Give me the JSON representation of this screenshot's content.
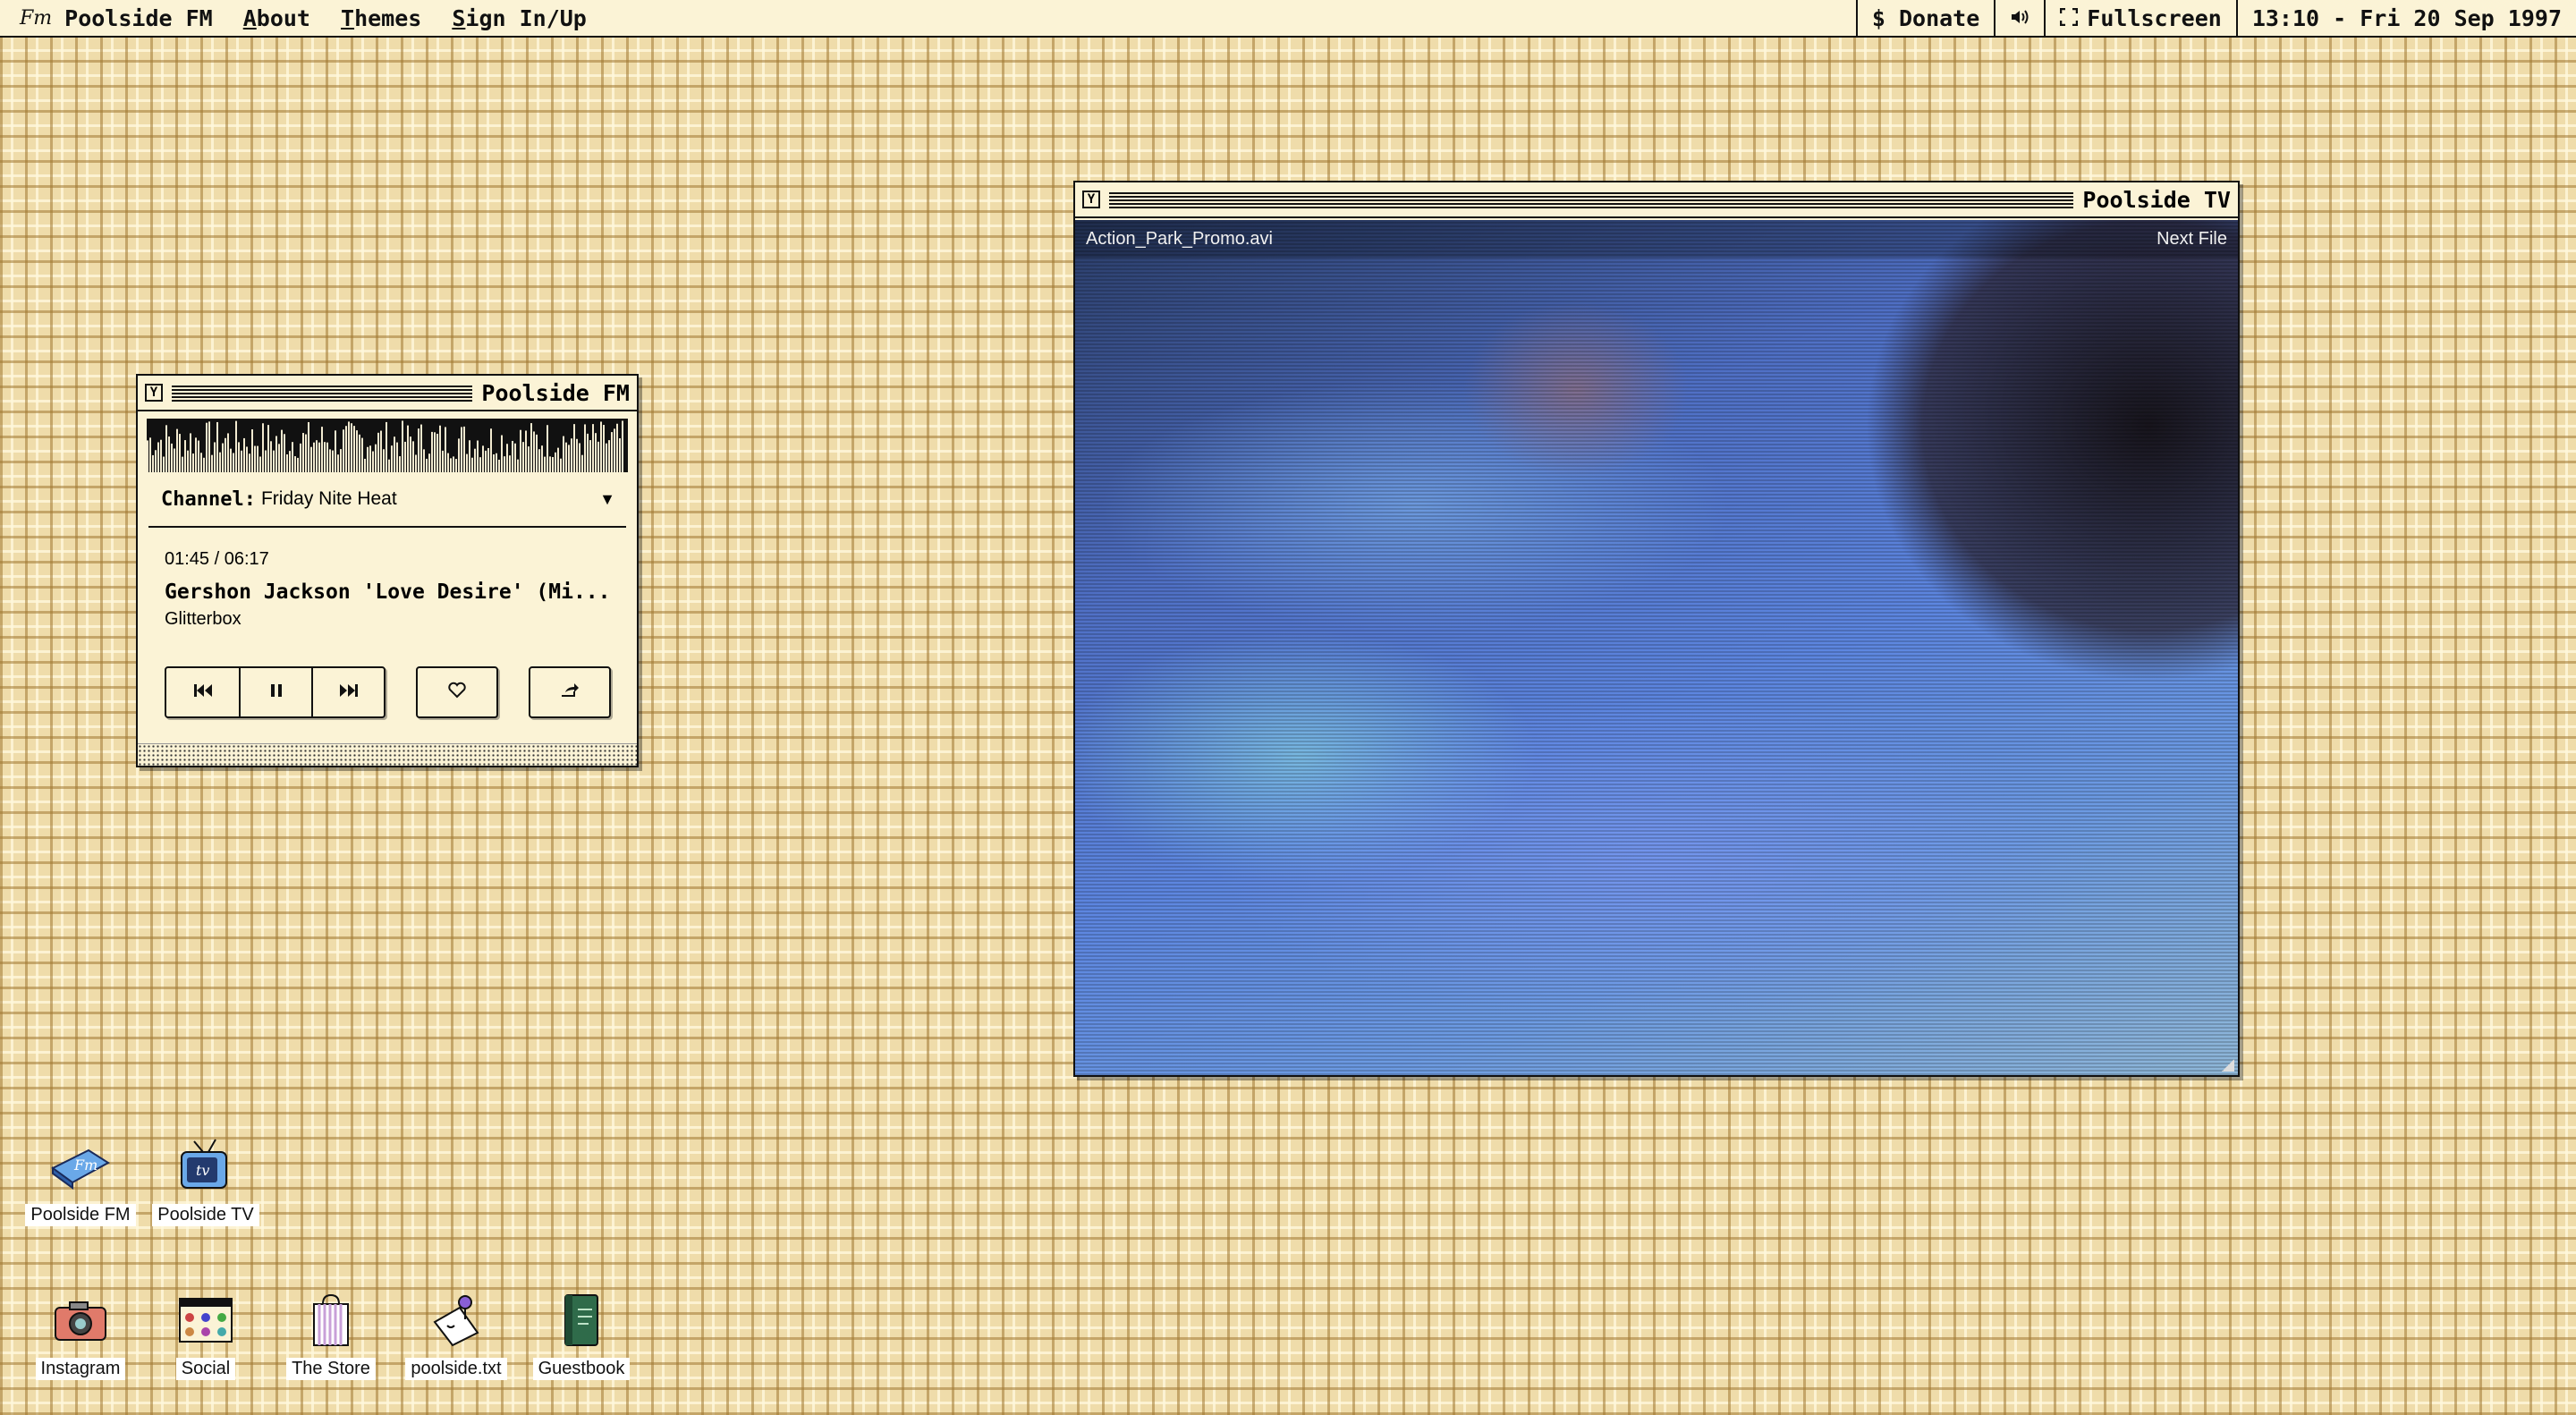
{
  "menubar": {
    "logo": "Fm",
    "app_name": "Poolside FM",
    "menu_items": [
      "About",
      "Themes",
      "Sign In/Up"
    ],
    "donate": "$ Donate",
    "volume_icon": "volume-icon",
    "fullscreen": "Fullscreen",
    "clock": "13:10 - Fri 20 Sep 1997"
  },
  "fm_window": {
    "title": "Poolside FM",
    "close_glyph": "Y",
    "channel_label": "Channel:",
    "channel_value": "Friday Nite Heat",
    "time": "01:45 / 06:17",
    "track_title": "Gershon Jackson 'Love Desire' (Mi...",
    "artist": "Glitterbox",
    "controls": {
      "prev_icon": "previous-track-icon",
      "pause_icon": "pause-icon",
      "next_icon": "next-track-icon",
      "like_icon": "heart-icon",
      "share_icon": "share-icon"
    }
  },
  "tv_window": {
    "title": "Poolside TV",
    "close_glyph": "Y",
    "filename": "Action_Park_Promo.avi",
    "next_file": "Next File"
  },
  "desktop_icons": [
    {
      "label": "Poolside FM",
      "icon": "poolside-fm-icon"
    },
    {
      "label": "Poolside TV",
      "icon": "poolside-tv-icon"
    },
    {
      "label": "Instagram",
      "icon": "camera-icon"
    },
    {
      "label": "Social",
      "icon": "social-window-icon"
    },
    {
      "label": "The Store",
      "icon": "shopping-bag-icon"
    },
    {
      "label": "poolside.txt",
      "icon": "note-pin-icon"
    },
    {
      "label": "Guestbook",
      "icon": "book-icon"
    }
  ]
}
